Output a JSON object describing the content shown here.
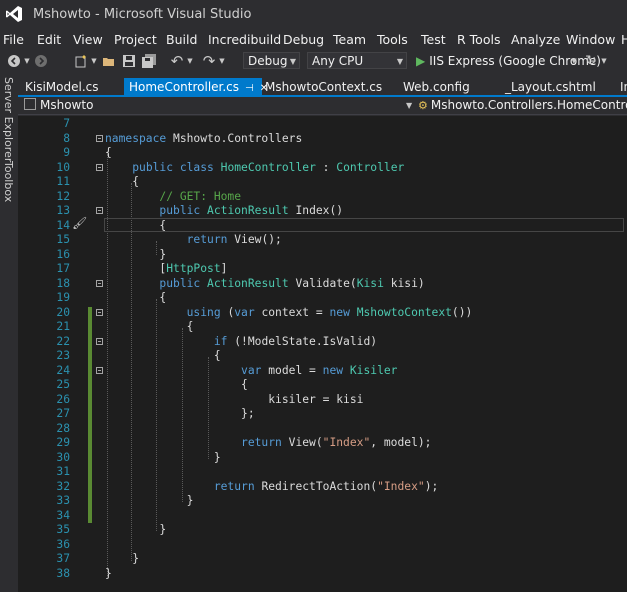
{
  "window": {
    "title": "Mshowto - Microsoft Visual Studio"
  },
  "menu": [
    "File",
    "Edit",
    "View",
    "Project",
    "Build",
    "Incredibuild",
    "Debug",
    "Team",
    "Tools",
    "Test",
    "R Tools",
    "Analyze",
    "Window",
    "H"
  ],
  "toolbar": {
    "configuration": "Debug",
    "platform": "Any CPU",
    "run_label": "IIS Express (Google Chrome)"
  },
  "side_tabs": [
    "Server Explorer",
    "Toolbox"
  ],
  "tabs": [
    {
      "label": "KisiModel.cs",
      "active": false
    },
    {
      "label": "HomeController.cs",
      "active": true
    },
    {
      "label": "MshowtoContext.cs",
      "active": false
    },
    {
      "label": "Web.config",
      "active": false
    },
    {
      "label": "_Layout.cshtml",
      "active": false
    },
    {
      "label": "In",
      "active": false
    }
  ],
  "nav": {
    "project": "Mshowto",
    "member": "Mshowto.Controllers.HomeController"
  },
  "colors": {
    "accent": "#007acc",
    "keyword": "#569cd6",
    "type": "#4ec9b0",
    "string": "#d69d85",
    "comment": "#57a64a",
    "line_number": "#2b91af",
    "change_bar": "#5a8a33"
  },
  "icons": [
    "visual-studio-logo-icon",
    "back-icon",
    "forward-icon",
    "new-project-icon",
    "open-icon",
    "save-icon",
    "save-all-icon",
    "undo-icon",
    "redo-icon",
    "play-icon",
    "refresh-icon",
    "brush-icon"
  ],
  "code_lines": [
    {
      "n": "7",
      "tokens": []
    },
    {
      "n": "8",
      "tokens": [
        [
          "k",
          "namespace"
        ],
        [
          "p",
          " Mshowto.Controllers"
        ]
      ]
    },
    {
      "n": "9",
      "tokens": [
        [
          "p",
          "{"
        ]
      ]
    },
    {
      "n": "10",
      "tokens": [
        [
          "p",
          "    "
        ],
        [
          "k",
          "public class"
        ],
        [
          "p",
          " "
        ],
        [
          "t",
          "HomeController"
        ],
        [
          "p",
          " : "
        ],
        [
          "t",
          "Controller"
        ]
      ]
    },
    {
      "n": "11",
      "tokens": [
        [
          "p",
          "    {"
        ]
      ]
    },
    {
      "n": "12",
      "tokens": [
        [
          "p",
          "        "
        ],
        [
          "c",
          "// GET: Home"
        ]
      ]
    },
    {
      "n": "13",
      "tokens": [
        [
          "p",
          "        "
        ],
        [
          "k",
          "public"
        ],
        [
          "p",
          " "
        ],
        [
          "t",
          "ActionResult"
        ],
        [
          "p",
          " Index()"
        ]
      ]
    },
    {
      "n": "14",
      "tokens": [
        [
          "p",
          "        {"
        ]
      ]
    },
    {
      "n": "15",
      "tokens": [
        [
          "p",
          "            "
        ],
        [
          "k",
          "return"
        ],
        [
          "p",
          " View();"
        ]
      ]
    },
    {
      "n": "16",
      "tokens": [
        [
          "p",
          "        }"
        ]
      ]
    },
    {
      "n": "17",
      "tokens": [
        [
          "p",
          "        ["
        ],
        [
          "t",
          "HttpPost"
        ],
        [
          "p",
          "]"
        ]
      ]
    },
    {
      "n": "18",
      "tokens": [
        [
          "p",
          "        "
        ],
        [
          "k",
          "public"
        ],
        [
          "p",
          " "
        ],
        [
          "t",
          "ActionResult"
        ],
        [
          "p",
          " Validate("
        ],
        [
          "t",
          "Kisi"
        ],
        [
          "p",
          " kisi)"
        ]
      ]
    },
    {
      "n": "19",
      "tokens": [
        [
          "p",
          "        {"
        ]
      ]
    },
    {
      "n": "20",
      "tokens": [
        [
          "p",
          "            "
        ],
        [
          "k",
          "using"
        ],
        [
          "p",
          " ("
        ],
        [
          "k",
          "var"
        ],
        [
          "p",
          " context = "
        ],
        [
          "k",
          "new"
        ],
        [
          "p",
          " "
        ],
        [
          "t",
          "MshowtoContext"
        ],
        [
          "p",
          "())"
        ]
      ]
    },
    {
      "n": "21",
      "tokens": [
        [
          "p",
          "            {"
        ]
      ]
    },
    {
      "n": "22",
      "tokens": [
        [
          "p",
          "                "
        ],
        [
          "k",
          "if"
        ],
        [
          "p",
          " (!ModelState.IsValid)"
        ]
      ]
    },
    {
      "n": "23",
      "tokens": [
        [
          "p",
          "                {"
        ]
      ]
    },
    {
      "n": "24",
      "tokens": [
        [
          "p",
          "                    "
        ],
        [
          "k",
          "var"
        ],
        [
          "p",
          " model = "
        ],
        [
          "k",
          "new"
        ],
        [
          "p",
          " "
        ],
        [
          "t",
          "Kisiler"
        ]
      ]
    },
    {
      "n": "25",
      "tokens": [
        [
          "p",
          "                    {"
        ]
      ]
    },
    {
      "n": "26",
      "tokens": [
        [
          "p",
          "                        kisiler = kisi"
        ]
      ]
    },
    {
      "n": "27",
      "tokens": [
        [
          "p",
          "                    };"
        ]
      ]
    },
    {
      "n": "28",
      "tokens": []
    },
    {
      "n": "29",
      "tokens": [
        [
          "p",
          "                    "
        ],
        [
          "k",
          "return"
        ],
        [
          "p",
          " View("
        ],
        [
          "s",
          "\"Index\""
        ],
        [
          "p",
          ", model);"
        ]
      ]
    },
    {
      "n": "30",
      "tokens": [
        [
          "p",
          "                }"
        ]
      ]
    },
    {
      "n": "31",
      "tokens": []
    },
    {
      "n": "32",
      "tokens": [
        [
          "p",
          "                "
        ],
        [
          "k",
          "return"
        ],
        [
          "p",
          " RedirectToAction("
        ],
        [
          "s",
          "\"Index\""
        ],
        [
          "p",
          ");"
        ]
      ]
    },
    {
      "n": "33",
      "tokens": [
        [
          "p",
          "            }"
        ]
      ]
    },
    {
      "n": "34",
      "tokens": []
    },
    {
      "n": "35",
      "tokens": [
        [
          "p",
          "        }"
        ]
      ]
    },
    {
      "n": "36",
      "tokens": []
    },
    {
      "n": "37",
      "tokens": [
        [
          "p",
          "    }"
        ]
      ]
    },
    {
      "n": "38",
      "tokens": [
        [
          "p",
          "}"
        ]
      ]
    }
  ]
}
